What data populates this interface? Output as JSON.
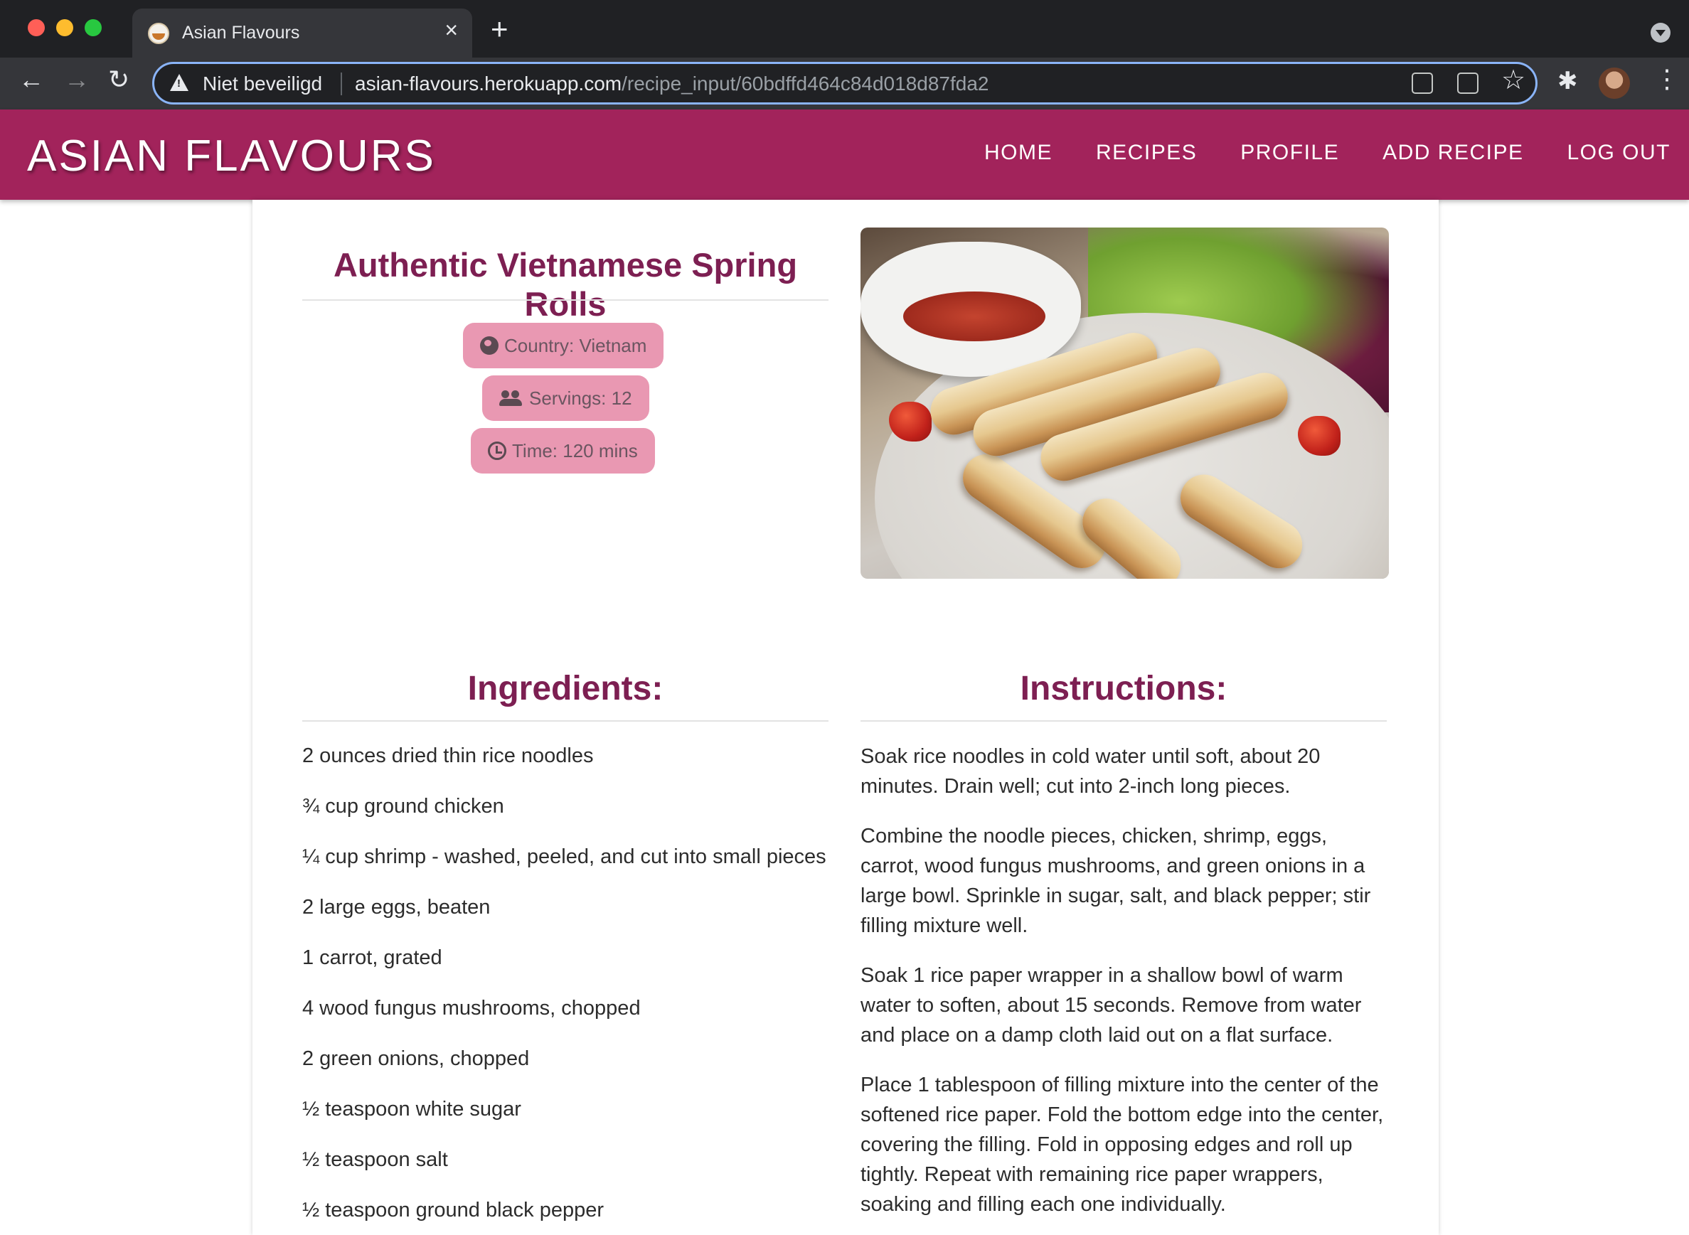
{
  "browser": {
    "tab_title": "Asian Flavours",
    "security_label": "Niet beveiligd",
    "url_host": "asian-flavours.herokuapp.com",
    "url_path": "/recipe_input/60bdffd464c84d018d87fda2",
    "icons": [
      "back-arrow-icon",
      "forward-arrow-icon",
      "reload-icon",
      "warning-icon",
      "qr-code-icon",
      "translate-icon",
      "bookmark-star-icon",
      "extensions-puzzle-icon",
      "profile-avatar",
      "more-menu-icon"
    ]
  },
  "site": {
    "brand": "ASIAN FLAVOURS",
    "brand_color": "#a2235b",
    "nav": [
      "HOME",
      "RECIPES",
      "PROFILE",
      "ADD RECIPE",
      "LOG OUT"
    ]
  },
  "recipe": {
    "title": "Authentic Vietnamese Spring Rolls",
    "country": "Country: Vietnam",
    "servings": "Servings: 12",
    "time": "Time: 120 mins",
    "badge_color": "#e998b2",
    "title_color": "#7d1f52"
  },
  "ingredients": {
    "heading": "Ingredients:",
    "items": [
      "2 ounces dried thin rice noodles",
      "¾ cup ground chicken",
      "¼ cup shrimp - washed, peeled, and cut into small pieces",
      "2 large eggs, beaten",
      "1 carrot, grated",
      "4 wood fungus mushrooms, chopped",
      "2 green onions, chopped",
      "½ teaspoon white sugar",
      "½ teaspoon salt",
      "½ teaspoon ground black pepper"
    ]
  },
  "instructions": {
    "heading": "Instructions:",
    "steps": [
      "Soak rice noodles in cold water until soft, about 20 minutes. Drain well; cut into 2-inch long pieces.",
      "Combine the noodle pieces, chicken, shrimp, eggs, carrot, wood fungus mushrooms, and green onions in a large bowl. Sprinkle in sugar, salt, and black pepper; stir filling mixture well.",
      "Soak 1 rice paper wrapper in a shallow bowl of warm water to soften, about 15 seconds. Remove from water and place on a damp cloth laid out on a flat surface.",
      "Place 1 tablespoon of filling mixture into the center of the softened rice paper. Fold the bottom edge into the center, covering the filling. Fold in opposing edges and roll up tightly. Repeat with remaining rice paper wrappers, soaking and filling each one individually."
    ]
  }
}
